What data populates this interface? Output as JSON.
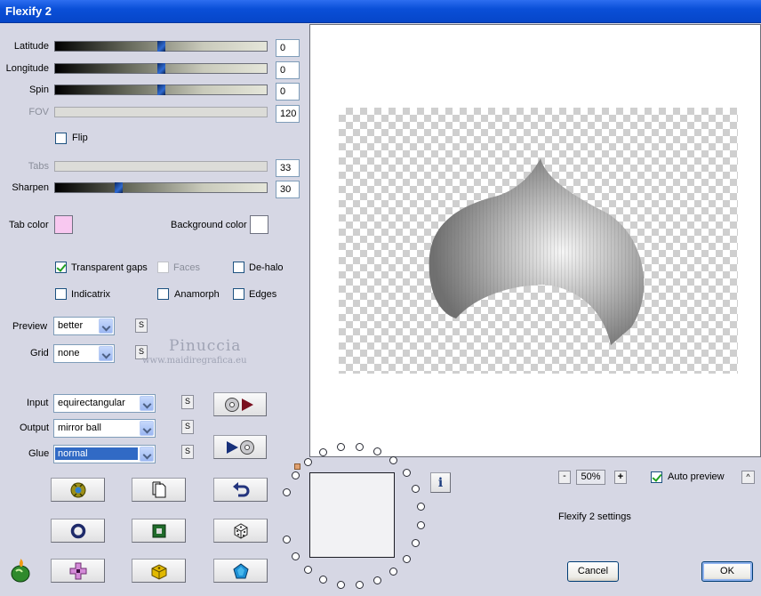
{
  "window": {
    "title": "Flexify 2"
  },
  "sliders": [
    {
      "label": "Latitude",
      "value": "0",
      "level": 0.5,
      "enabled": true
    },
    {
      "label": "Longitude",
      "value": "0",
      "level": 0.5,
      "enabled": true
    },
    {
      "label": "Spin",
      "value": "0",
      "level": 0.5,
      "enabled": true
    },
    {
      "label": "FOV",
      "value": "120",
      "level": null,
      "enabled": false
    },
    {
      "label": "Tabs",
      "value": "33",
      "level": null,
      "enabled": false
    },
    {
      "label": "Sharpen",
      "value": "30",
      "level": 0.3,
      "enabled": true
    }
  ],
  "flip": {
    "label": "Flip",
    "checked": false
  },
  "tab_color": {
    "label": "Tab color",
    "color": "#f8c8f0"
  },
  "background_color": {
    "label": "Background color",
    "color": "#ffffff"
  },
  "options": {
    "transparent_gaps": {
      "label": "Transparent gaps",
      "checked": true
    },
    "faces": {
      "label": "Faces",
      "checked": false
    },
    "de_halo": {
      "label": "De-halo",
      "checked": false
    },
    "indicatrix": {
      "label": "Indicatrix",
      "checked": false
    },
    "anamorph": {
      "label": "Anamorph",
      "checked": false
    },
    "edges": {
      "label": "Edges",
      "checked": false
    }
  },
  "preview_select": {
    "label": "Preview",
    "value": "better"
  },
  "grid_select": {
    "label": "Grid",
    "value": "none"
  },
  "input_select": {
    "label": "Input",
    "value": "equirectangular"
  },
  "output_select": {
    "label": "Output",
    "value": "mirror ball"
  },
  "glue_select": {
    "label": "Glue",
    "value": "normal"
  },
  "s_button_label": "S",
  "watermark": {
    "name": "Pinuccia",
    "url": "www.maidiregrafica.eu"
  },
  "zoom": {
    "minus": "-",
    "value": "50%",
    "plus": "+"
  },
  "auto_preview": {
    "label": "Auto preview",
    "checked": true
  },
  "collapse_label": "^",
  "settings_text": "Flexify 2 settings",
  "info_label": "i",
  "cancel_label": "Cancel",
  "ok_label": "OK",
  "colors": {
    "titlebar": "#0a4fd8",
    "dialog_bg": "#d6d7e4",
    "slider_thumb": "#1f4fa8"
  }
}
